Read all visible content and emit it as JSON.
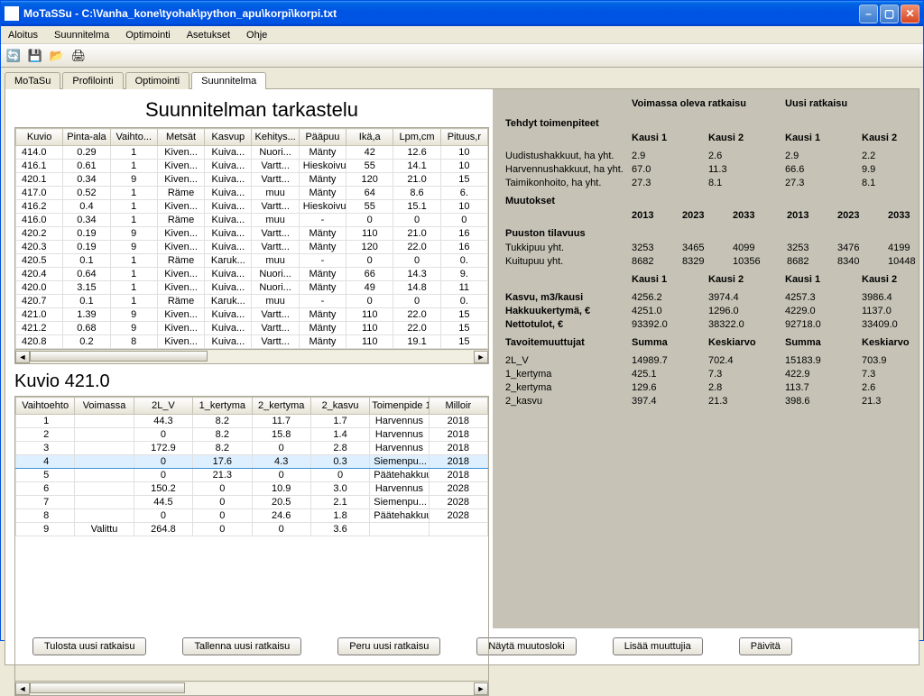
{
  "title": "MoTaSSu - C:\\Vanha_kone\\tyohak\\python_apu\\korpi\\korpi.txt",
  "menu": [
    "Aloitus",
    "Suunnitelma",
    "Optimointi",
    "Asetukset",
    "Ohje"
  ],
  "tabs": [
    "MoTaSu",
    "Profilointi",
    "Optimointi",
    "Suunnitelma"
  ],
  "active_tab": 3,
  "main_title": "Suunnitelman tarkastelu",
  "grid1": {
    "headers": [
      "Kuvio",
      "Pinta-ala",
      "Vaihto...",
      "Metsät",
      "Kasvup",
      "Kehitys...",
      "Pääpuu",
      "Ikä,a",
      "Lpm,cm",
      "Pituus,r"
    ],
    "rows": [
      [
        "414.0",
        "0.29",
        "1",
        "Kiven...",
        "Kuiva...",
        "Nuori...",
        "Mänty",
        "42",
        "12.6",
        "10"
      ],
      [
        "416.1",
        "0.61",
        "1",
        "Kiven...",
        "Kuiva...",
        "Vartt...",
        "Hieskoivu",
        "55",
        "14.1",
        "10"
      ],
      [
        "420.1",
        "0.34",
        "9",
        "Kiven...",
        "Kuiva...",
        "Vartt...",
        "Mänty",
        "120",
        "21.0",
        "15"
      ],
      [
        "417.0",
        "0.52",
        "1",
        "Räme",
        "Kuiva...",
        "muu",
        "Mänty",
        "64",
        "8.6",
        "6."
      ],
      [
        "416.2",
        "0.4",
        "1",
        "Kiven...",
        "Kuiva...",
        "Vartt...",
        "Hieskoivu",
        "55",
        "15.1",
        "10"
      ],
      [
        "416.0",
        "0.34",
        "1",
        "Räme",
        "Kuiva...",
        "muu",
        "-",
        "0",
        "0",
        "0"
      ],
      [
        "420.2",
        "0.19",
        "9",
        "Kiven...",
        "Kuiva...",
        "Vartt...",
        "Mänty",
        "110",
        "21.0",
        "16"
      ],
      [
        "420.3",
        "0.19",
        "9",
        "Kiven...",
        "Kuiva...",
        "Vartt...",
        "Mänty",
        "120",
        "22.0",
        "16"
      ],
      [
        "420.5",
        "0.1",
        "1",
        "Räme",
        "Karuk...",
        "muu",
        "-",
        "0",
        "0",
        "0."
      ],
      [
        "420.4",
        "0.64",
        "1",
        "Kiven...",
        "Kuiva...",
        "Nuori...",
        "Mänty",
        "66",
        "14.3",
        "9."
      ],
      [
        "420.0",
        "3.15",
        "1",
        "Kiven...",
        "Kuiva...",
        "Nuori...",
        "Mänty",
        "49",
        "14.8",
        "11"
      ],
      [
        "420.7",
        "0.1",
        "1",
        "Räme",
        "Karuk...",
        "muu",
        "-",
        "0",
        "0",
        "0."
      ],
      [
        "421.0",
        "1.39",
        "9",
        "Kiven...",
        "Kuiva...",
        "Vartt...",
        "Mänty",
        "110",
        "22.0",
        "15"
      ],
      [
        "421.2",
        "0.68",
        "9",
        "Kiven...",
        "Kuiva...",
        "Vartt...",
        "Mänty",
        "110",
        "22.0",
        "15"
      ],
      [
        "420.8",
        "0.2",
        "8",
        "Kiven...",
        "Kuiva...",
        "Vartt...",
        "Mänty",
        "110",
        "19.1",
        "15"
      ]
    ]
  },
  "detail_title": "Kuvio 421.0",
  "grid2": {
    "headers": [
      "Vaihtoehto",
      "Voimassa",
      "2L_V",
      "1_kertyma",
      "2_kertyma",
      "2_kasvu",
      "Toimenpide 1",
      "Milloir"
    ],
    "rows": [
      [
        "1",
        "",
        "44.3",
        "8.2",
        "11.7",
        "1.7",
        "Harvennus",
        "2018"
      ],
      [
        "2",
        "",
        "0",
        "8.2",
        "15.8",
        "1.4",
        "Harvennus",
        "2018"
      ],
      [
        "3",
        "",
        "172.9",
        "8.2",
        "0",
        "2.8",
        "Harvennus",
        "2018"
      ],
      [
        "4",
        "",
        "0",
        "17.6",
        "4.3",
        "0.3",
        "Siemenpu...",
        "2018"
      ],
      [
        "5",
        "",
        "0",
        "21.3",
        "0",
        "0",
        "Päätehakkuu",
        "2018"
      ],
      [
        "6",
        "",
        "150.2",
        "0",
        "10.9",
        "3.0",
        "Harvennus",
        "2028"
      ],
      [
        "7",
        "",
        "44.5",
        "0",
        "20.5",
        "2.1",
        "Siemenpu...",
        "2028"
      ],
      [
        "8",
        "",
        "0",
        "0",
        "24.6",
        "1.8",
        "Päätehakkuu",
        "2028"
      ],
      [
        "9",
        "Valittu",
        "264.8",
        "0",
        "0",
        "3.6",
        "",
        ""
      ]
    ],
    "selected": 3
  },
  "right": {
    "col1_title": "Voimassa oleva ratkaisu",
    "col2_title": "Uusi ratkaisu",
    "tehdyt_title": "Tehdyt toimenpiteet",
    "kausi1": "Kausi 1",
    "kausi2": "Kausi 2",
    "tehdyt": [
      [
        "Uudistushakkuut, ha yht.",
        "2.9",
        "2.6",
        "2.9",
        "2.2"
      ],
      [
        "Harvennushakkuut, ha yht.",
        "67.0",
        "11.3",
        "66.6",
        "9.9"
      ],
      [
        "Taimikonhoito, ha yht.",
        "27.3",
        "8.1",
        "27.3",
        "8.1"
      ]
    ],
    "muutokset_title": "Muutokset",
    "years": [
      "2013",
      "2023",
      "2033",
      "2013",
      "2023",
      "2033"
    ],
    "puusto_title": "Puuston tilavuus",
    "puusto": [
      [
        "Tukkipuu yht.",
        "3253",
        "3465",
        "4099",
        "3253",
        "3476",
        "4199"
      ],
      [
        "Kuitupuu yht.",
        "8682",
        "8329",
        "10356",
        "8682",
        "8340",
        "10448"
      ]
    ],
    "kausi_rows": [
      [
        "Kasvu, m3/kausi",
        "4256.2",
        "3974.4",
        "4257.3",
        "3986.4"
      ],
      [
        "Hakkuukertymä, €",
        "4251.0",
        "1296.0",
        "4229.0",
        "1137.0"
      ],
      [
        "Nettotulot, €",
        "93392.0",
        "38322.0",
        "92718.0",
        "33409.0"
      ]
    ],
    "tavoite_title": "Tavoitemuuttujat",
    "tavoite_head": [
      "Summa",
      "Keskiarvo",
      "Summa",
      "Keskiarvo"
    ],
    "tavoite": [
      [
        "2L_V",
        "14989.7",
        "702.4",
        "15183.9",
        "703.9"
      ],
      [
        "1_kertyma",
        "425.1",
        "7.3",
        "422.9",
        "7.3"
      ],
      [
        "2_kertyma",
        "129.6",
        "2.8",
        "113.7",
        "2.6"
      ],
      [
        "2_kasvu",
        "397.4",
        "21.3",
        "398.6",
        "21.3"
      ]
    ]
  },
  "buttons": [
    "Tulosta uusi ratkaisu",
    "Tallenna uusi ratkaisu",
    "Peru uusi ratkaisu",
    "Näytä muutosloki",
    "Lisää muuttujia",
    "Päivitä"
  ]
}
